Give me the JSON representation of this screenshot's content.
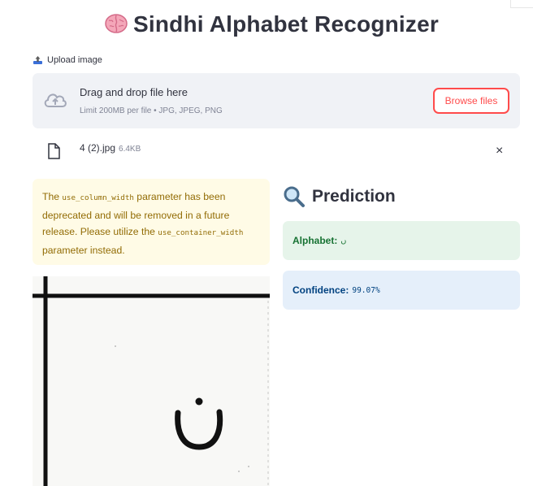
{
  "header": {
    "title": "Sindhi Alphabet Recognizer",
    "title_icon": "brain-icon"
  },
  "uploader": {
    "label": "Upload image",
    "label_icon": "upload-icon",
    "drop_text": "Drag and drop file here",
    "limit_text": "Limit 200MB per file • JPG, JPEG, PNG",
    "browse_label": "Browse files",
    "cloud_icon": "cloud-upload-icon"
  },
  "file": {
    "name": "4 (2).jpg",
    "size": "6.4KB",
    "file_icon": "file-icon",
    "close_label": "×"
  },
  "warning": {
    "part1": "The ",
    "code1": "use_column_width",
    "part2": " parameter has been deprecated and will be removed in a future release. Please utilize the ",
    "code2": "use_container_width",
    "part3": " parameter instead."
  },
  "prediction": {
    "heading": "Prediction",
    "heading_icon": "magnifier-icon",
    "alphabet_label": "Alphabet:",
    "alphabet_value": "ں",
    "confidence_label": "Confidence:",
    "confidence_value": "99.07%"
  },
  "colors": {
    "accent": "#ff4b4b",
    "warning_bg": "#fffbe6",
    "success_bg": "#e6f4ea",
    "info_bg": "#e5effa",
    "dropzone_bg": "#f0f2f6"
  }
}
